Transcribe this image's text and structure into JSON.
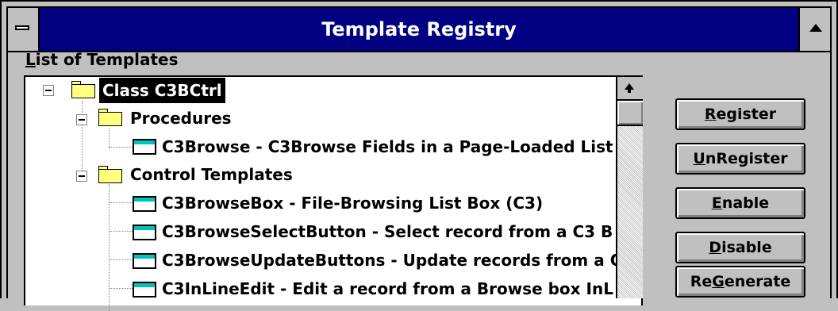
{
  "window": {
    "title": "Template Registry"
  },
  "list": {
    "label_prefix": "L",
    "label_rest": "ist of Templates",
    "rows": [
      "Class C3BCtrl",
      "Procedures",
      "C3Browse - C3Browse Fields in a Page-Loaded List",
      "Control Templates",
      "C3BrowseBox - File-Browsing List Box (C3)",
      "C3BrowseSelectButton - Select record from a C3 B",
      "C3BrowseUpdateButtons - Update records from a C",
      "C3InLineEdit - Edit a record from a Browse box InL"
    ]
  },
  "buttons": {
    "register": {
      "pre": "",
      "u": "R",
      "post": "egister"
    },
    "unregister": {
      "pre": "",
      "u": "U",
      "post": "nRegister"
    },
    "enable": {
      "pre": "",
      "u": "E",
      "post": "nable"
    },
    "disable": {
      "pre": "",
      "u": "D",
      "post": "isable"
    },
    "regenerate": {
      "pre": "Re",
      "u": "G",
      "post": "enerate"
    }
  },
  "icons": {
    "folder_color": "#ffff80",
    "template_stripe_color": "#00c0c0",
    "selection_color": "#000000",
    "titlebar_color": "#000080"
  }
}
